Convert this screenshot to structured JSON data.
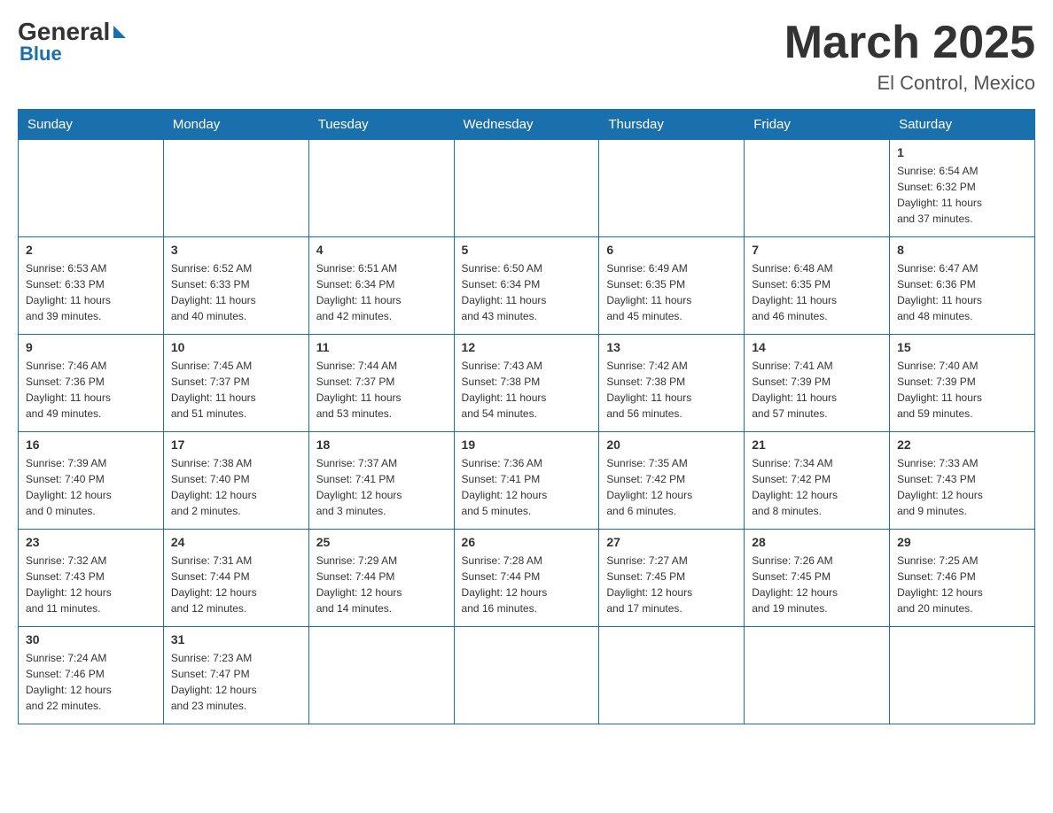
{
  "header": {
    "logo_general": "General",
    "logo_blue": "Blue",
    "month_title": "March 2025",
    "location": "El Control, Mexico"
  },
  "weekdays": [
    "Sunday",
    "Monday",
    "Tuesday",
    "Wednesday",
    "Thursday",
    "Friday",
    "Saturday"
  ],
  "weeks": [
    [
      {
        "day": "",
        "info": ""
      },
      {
        "day": "",
        "info": ""
      },
      {
        "day": "",
        "info": ""
      },
      {
        "day": "",
        "info": ""
      },
      {
        "day": "",
        "info": ""
      },
      {
        "day": "",
        "info": ""
      },
      {
        "day": "1",
        "info": "Sunrise: 6:54 AM\nSunset: 6:32 PM\nDaylight: 11 hours\nand 37 minutes."
      }
    ],
    [
      {
        "day": "2",
        "info": "Sunrise: 6:53 AM\nSunset: 6:33 PM\nDaylight: 11 hours\nand 39 minutes."
      },
      {
        "day": "3",
        "info": "Sunrise: 6:52 AM\nSunset: 6:33 PM\nDaylight: 11 hours\nand 40 minutes."
      },
      {
        "day": "4",
        "info": "Sunrise: 6:51 AM\nSunset: 6:34 PM\nDaylight: 11 hours\nand 42 minutes."
      },
      {
        "day": "5",
        "info": "Sunrise: 6:50 AM\nSunset: 6:34 PM\nDaylight: 11 hours\nand 43 minutes."
      },
      {
        "day": "6",
        "info": "Sunrise: 6:49 AM\nSunset: 6:35 PM\nDaylight: 11 hours\nand 45 minutes."
      },
      {
        "day": "7",
        "info": "Sunrise: 6:48 AM\nSunset: 6:35 PM\nDaylight: 11 hours\nand 46 minutes."
      },
      {
        "day": "8",
        "info": "Sunrise: 6:47 AM\nSunset: 6:36 PM\nDaylight: 11 hours\nand 48 minutes."
      }
    ],
    [
      {
        "day": "9",
        "info": "Sunrise: 7:46 AM\nSunset: 7:36 PM\nDaylight: 11 hours\nand 49 minutes."
      },
      {
        "day": "10",
        "info": "Sunrise: 7:45 AM\nSunset: 7:37 PM\nDaylight: 11 hours\nand 51 minutes."
      },
      {
        "day": "11",
        "info": "Sunrise: 7:44 AM\nSunset: 7:37 PM\nDaylight: 11 hours\nand 53 minutes."
      },
      {
        "day": "12",
        "info": "Sunrise: 7:43 AM\nSunset: 7:38 PM\nDaylight: 11 hours\nand 54 minutes."
      },
      {
        "day": "13",
        "info": "Sunrise: 7:42 AM\nSunset: 7:38 PM\nDaylight: 11 hours\nand 56 minutes."
      },
      {
        "day": "14",
        "info": "Sunrise: 7:41 AM\nSunset: 7:39 PM\nDaylight: 11 hours\nand 57 minutes."
      },
      {
        "day": "15",
        "info": "Sunrise: 7:40 AM\nSunset: 7:39 PM\nDaylight: 11 hours\nand 59 minutes."
      }
    ],
    [
      {
        "day": "16",
        "info": "Sunrise: 7:39 AM\nSunset: 7:40 PM\nDaylight: 12 hours\nand 0 minutes."
      },
      {
        "day": "17",
        "info": "Sunrise: 7:38 AM\nSunset: 7:40 PM\nDaylight: 12 hours\nand 2 minutes."
      },
      {
        "day": "18",
        "info": "Sunrise: 7:37 AM\nSunset: 7:41 PM\nDaylight: 12 hours\nand 3 minutes."
      },
      {
        "day": "19",
        "info": "Sunrise: 7:36 AM\nSunset: 7:41 PM\nDaylight: 12 hours\nand 5 minutes."
      },
      {
        "day": "20",
        "info": "Sunrise: 7:35 AM\nSunset: 7:42 PM\nDaylight: 12 hours\nand 6 minutes."
      },
      {
        "day": "21",
        "info": "Sunrise: 7:34 AM\nSunset: 7:42 PM\nDaylight: 12 hours\nand 8 minutes."
      },
      {
        "day": "22",
        "info": "Sunrise: 7:33 AM\nSunset: 7:43 PM\nDaylight: 12 hours\nand 9 minutes."
      }
    ],
    [
      {
        "day": "23",
        "info": "Sunrise: 7:32 AM\nSunset: 7:43 PM\nDaylight: 12 hours\nand 11 minutes."
      },
      {
        "day": "24",
        "info": "Sunrise: 7:31 AM\nSunset: 7:44 PM\nDaylight: 12 hours\nand 12 minutes."
      },
      {
        "day": "25",
        "info": "Sunrise: 7:29 AM\nSunset: 7:44 PM\nDaylight: 12 hours\nand 14 minutes."
      },
      {
        "day": "26",
        "info": "Sunrise: 7:28 AM\nSunset: 7:44 PM\nDaylight: 12 hours\nand 16 minutes."
      },
      {
        "day": "27",
        "info": "Sunrise: 7:27 AM\nSunset: 7:45 PM\nDaylight: 12 hours\nand 17 minutes."
      },
      {
        "day": "28",
        "info": "Sunrise: 7:26 AM\nSunset: 7:45 PM\nDaylight: 12 hours\nand 19 minutes."
      },
      {
        "day": "29",
        "info": "Sunrise: 7:25 AM\nSunset: 7:46 PM\nDaylight: 12 hours\nand 20 minutes."
      }
    ],
    [
      {
        "day": "30",
        "info": "Sunrise: 7:24 AM\nSunset: 7:46 PM\nDaylight: 12 hours\nand 22 minutes."
      },
      {
        "day": "31",
        "info": "Sunrise: 7:23 AM\nSunset: 7:47 PM\nDaylight: 12 hours\nand 23 minutes."
      },
      {
        "day": "",
        "info": ""
      },
      {
        "day": "",
        "info": ""
      },
      {
        "day": "",
        "info": ""
      },
      {
        "day": "",
        "info": ""
      },
      {
        "day": "",
        "info": ""
      }
    ]
  ]
}
